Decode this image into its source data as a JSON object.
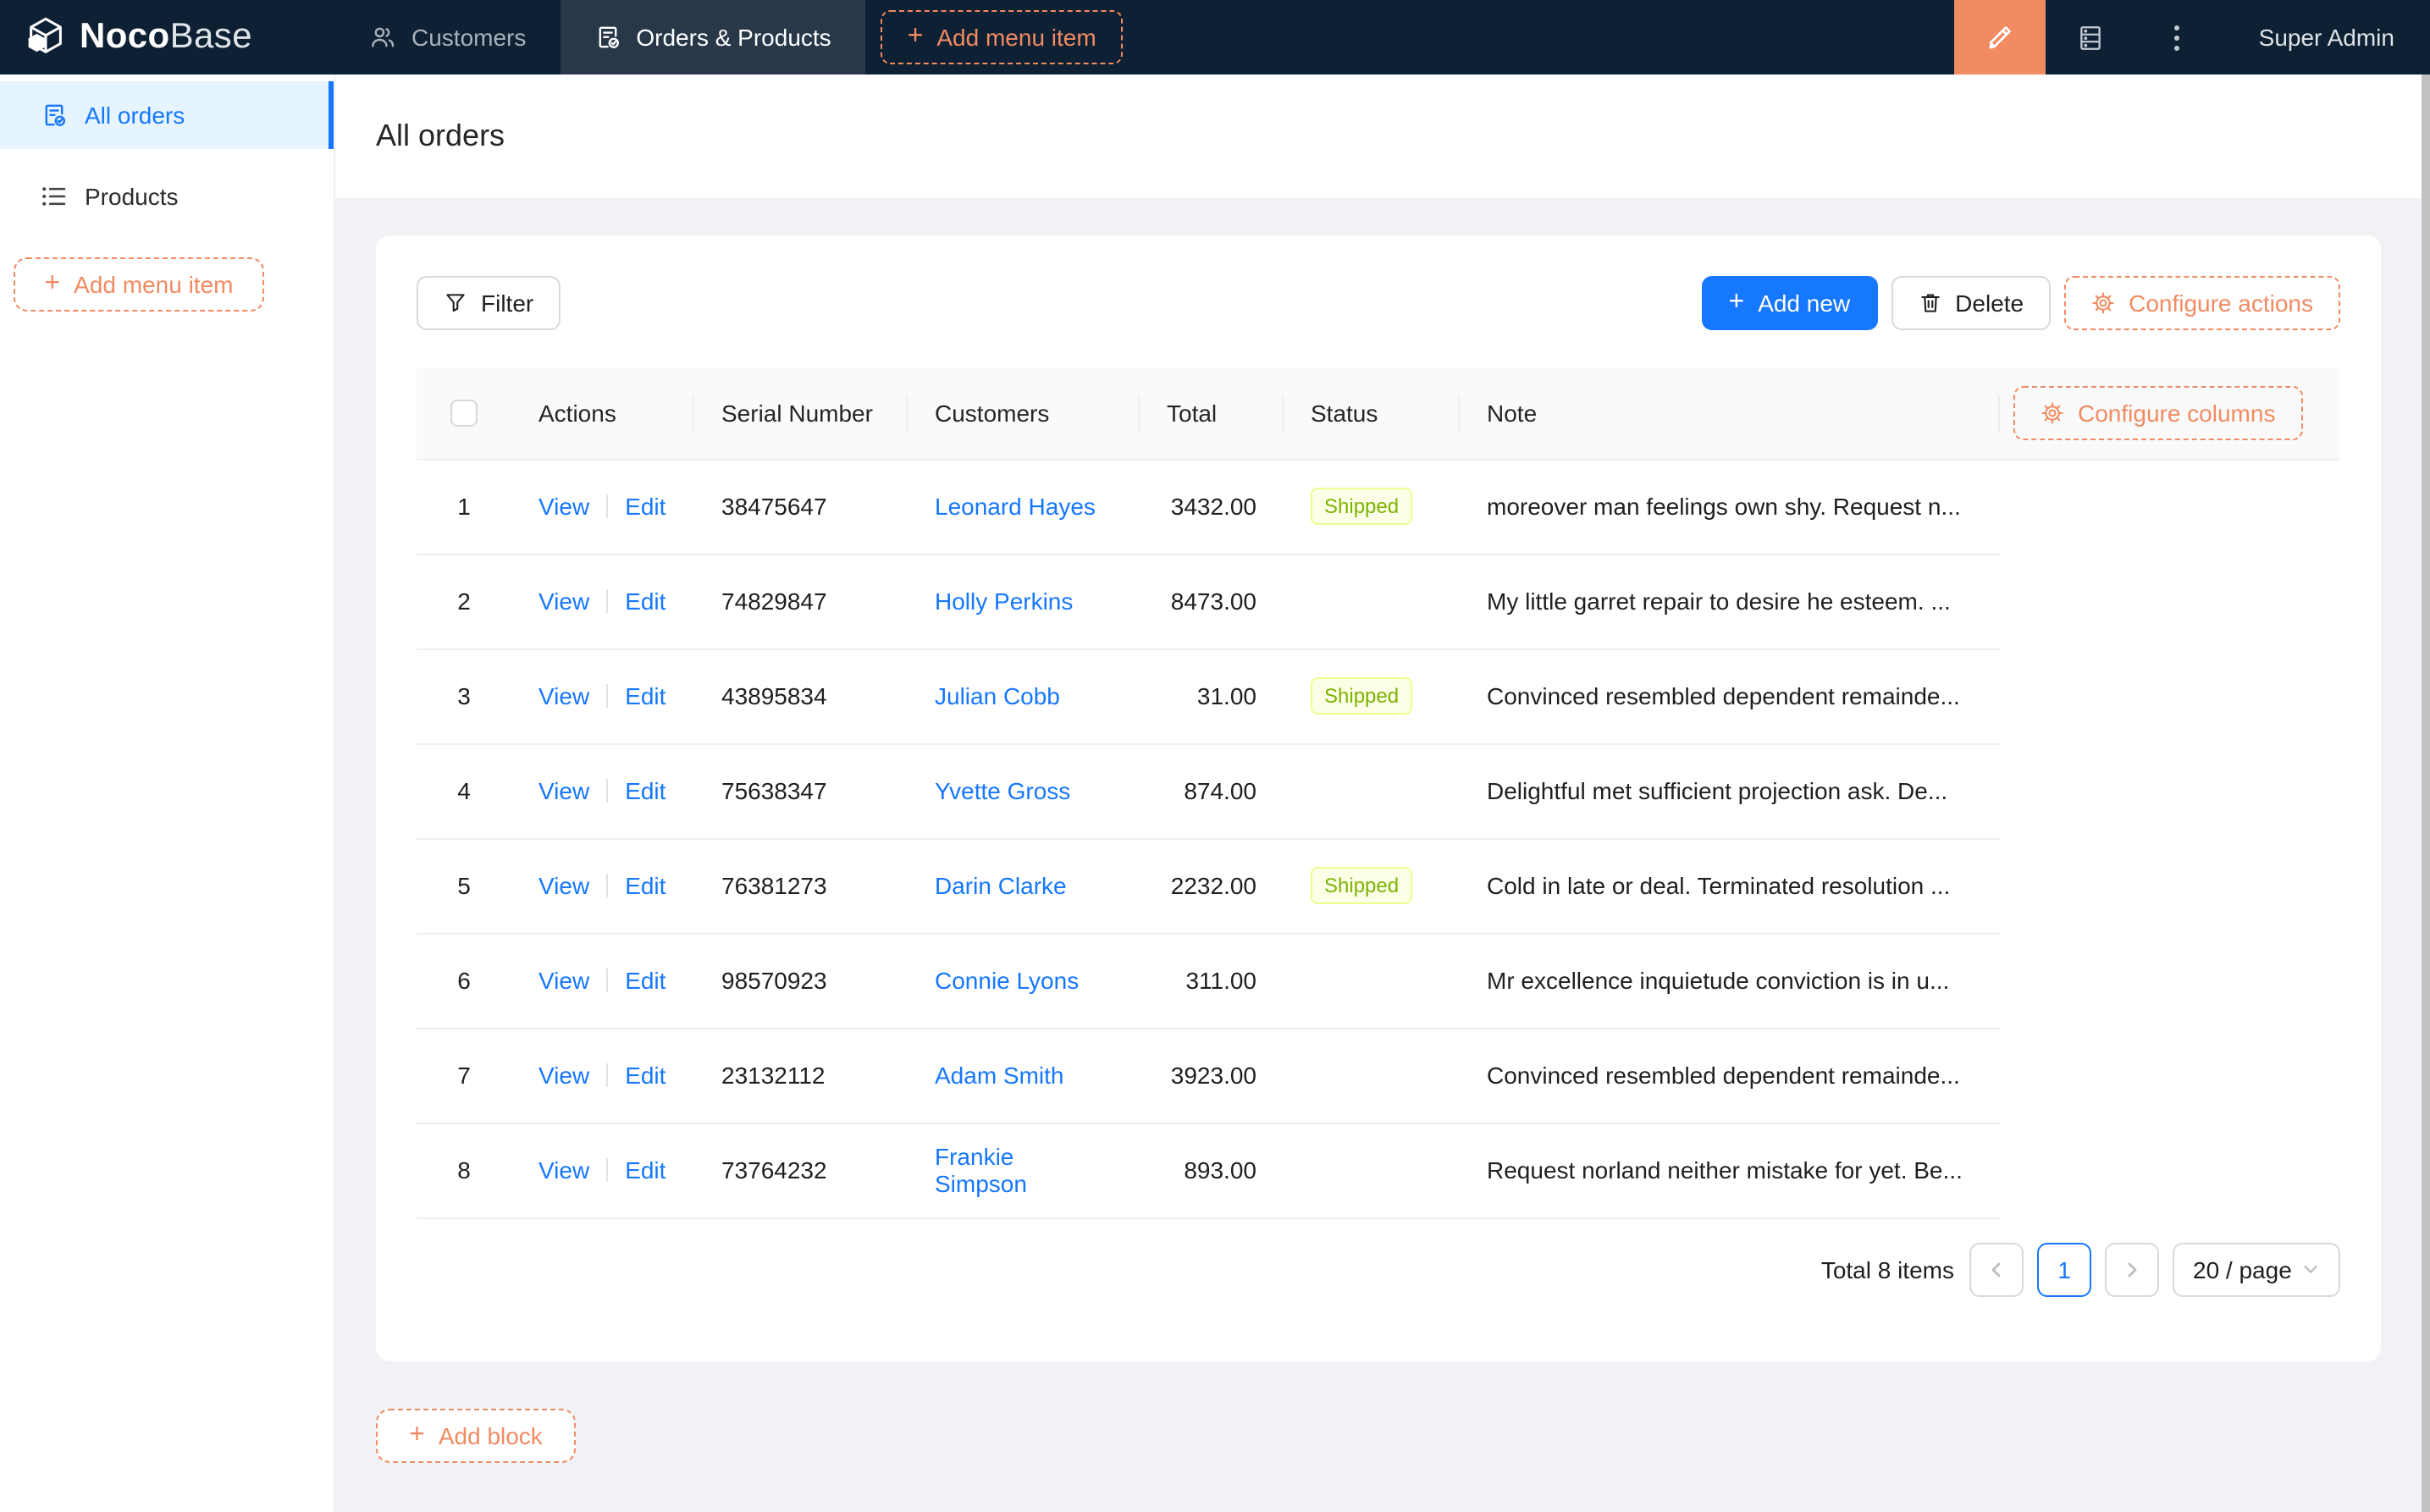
{
  "navbar": {
    "logo": {
      "bold": "Noco",
      "light": "Base"
    },
    "tabs": [
      {
        "label": "Customers",
        "active": false
      },
      {
        "label": "Orders & Products",
        "active": true
      }
    ],
    "add_menu_item_label": "Add menu item",
    "user_name": "Super Admin"
  },
  "sidebar": {
    "items": [
      {
        "label": "All orders",
        "active": true
      },
      {
        "label": "Products",
        "active": false
      }
    ],
    "add_menu_item_label": "Add menu item"
  },
  "page": {
    "title": "All orders"
  },
  "toolbar": {
    "filter_label": "Filter",
    "add_new_label": "Add new",
    "delete_label": "Delete",
    "configure_actions_label": "Configure actions"
  },
  "table": {
    "configure_columns_label": "Configure columns",
    "view_label": "View",
    "edit_label": "Edit",
    "columns": [
      "Actions",
      "Serial Number",
      "Customers",
      "Total",
      "Status",
      "Note"
    ],
    "rows": [
      {
        "index": "1",
        "serial": "38475647",
        "customer": "Leonard Hayes",
        "total": "3432.00",
        "status": "Shipped",
        "note": "moreover man feelings own shy. Request n..."
      },
      {
        "index": "2",
        "serial": "74829847",
        "customer": "Holly Perkins",
        "total": "8473.00",
        "status": "",
        "note": "My little garret repair to desire he esteem. ..."
      },
      {
        "index": "3",
        "serial": "43895834",
        "customer": "Julian Cobb",
        "total": "31.00",
        "status": "Shipped",
        "note": "Convinced resembled dependent remainde..."
      },
      {
        "index": "4",
        "serial": "75638347",
        "customer": "Yvette Gross",
        "total": "874.00",
        "status": "",
        "note": "Delightful met sufficient projection ask. De..."
      },
      {
        "index": "5",
        "serial": "76381273",
        "customer": "Darin Clarke",
        "total": "2232.00",
        "status": "Shipped",
        "note": "Cold in late or deal. Terminated resolution ..."
      },
      {
        "index": "6",
        "serial": "98570923",
        "customer": "Connie Lyons",
        "total": "311.00",
        "status": "",
        "note": "Mr excellence inquietude conviction is in u..."
      },
      {
        "index": "7",
        "serial": "23132112",
        "customer": "Adam Smith",
        "total": "3923.00",
        "status": "",
        "note": "Convinced resembled dependent remainde..."
      },
      {
        "index": "8",
        "serial": "73764232",
        "customer": "Frankie Simpson",
        "total": "893.00",
        "status": "",
        "note": "Request norland neither mistake for yet. Be..."
      }
    ]
  },
  "pagination": {
    "total_text": "Total 8 items",
    "current_page": "1",
    "page_size_label": "20 / page"
  },
  "add_block_label": "Add block",
  "icons": {
    "plus": "+"
  },
  "colors": {
    "navbar_bg": "#0e2033",
    "designer_orange": "#f18b62",
    "accent_blue": "#1677ff",
    "selected_menu_bg": "#e6f4ff",
    "content_bg": "#f0f2f5",
    "table_header_bg": "#fafafa",
    "status_shipped_bg": "#fcffe6",
    "status_shipped_border": "#eaff8f",
    "status_shipped_text": "#7cb305"
  }
}
